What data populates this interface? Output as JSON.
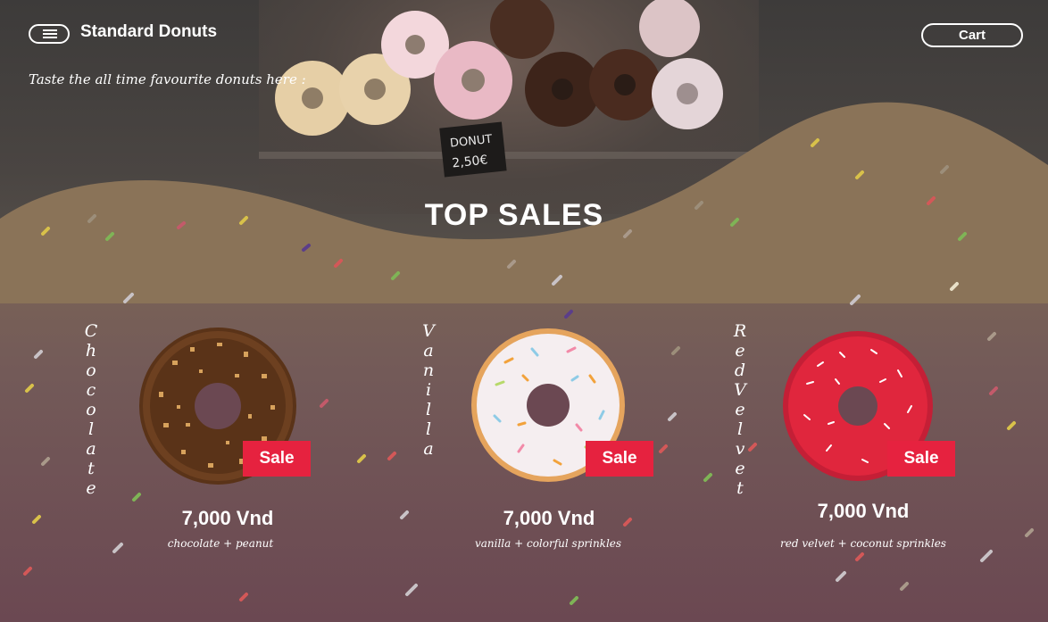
{
  "header": {
    "brand": "Standard Donuts",
    "cart_label": "Cart",
    "menu_icon": "hamburger-menu-icon"
  },
  "hero": {
    "tagline": "Taste the all time favourite donuts here :",
    "section_title": "TOP SALES",
    "sign_text_1": "DONUT",
    "sign_text_2": "2,50€"
  },
  "products": [
    {
      "flavor": "Chocolate",
      "badge": "Sale",
      "price": "7,000 Vnd",
      "description": "chocolate + peanut",
      "glaze_color": "#5a3318",
      "topping_color": "#d7a25c"
    },
    {
      "flavor": "Vanilla",
      "badge": "Sale",
      "price": "7,000 Vnd",
      "description": "vanilla + colorful sprinkles",
      "glaze_color": "#f5eef0",
      "topping_color": "#f2a23b"
    },
    {
      "flavor": "RedVelvet",
      "badge": "Sale",
      "price": "7,000 Vnd",
      "description": "red velvet + coconut sprinkles",
      "glaze_color": "#e0263d",
      "topping_color": "#ffffff"
    }
  ],
  "colors": {
    "accent_sale": "#e6223f",
    "text": "#ffffff"
  }
}
